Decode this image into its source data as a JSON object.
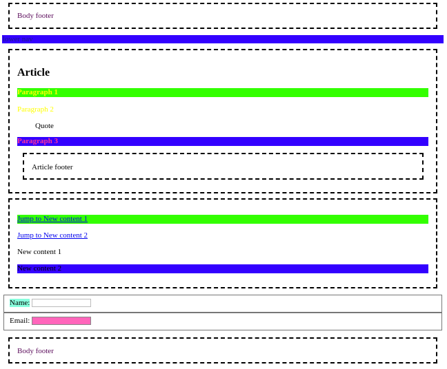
{
  "top_footer": {
    "text": "Body footer"
  },
  "lower_nav": {
    "text": "lower nav"
  },
  "article": {
    "title": "Article",
    "paragraph_1": "Paragraph 1",
    "paragraph_2": "Paragraph 2",
    "quote": "Quote",
    "paragraph_3": "Paragraph 3",
    "footer": "Article footer"
  },
  "nav_section": {
    "jump_1": "Jump to New content 1",
    "jump_2": "Jump to New content 2",
    "content_1": "New content 1",
    "content_2": "New content 2"
  },
  "form": {
    "name_label": "Name:",
    "name_value": "",
    "email_label": "Email:",
    "email_value": ""
  },
  "bottom_footer": {
    "text": "Body footer"
  },
  "colors": {
    "green_bar": "#33ff00",
    "blue_bar": "#3300ff",
    "yellow_text": "#ffff00",
    "pink_text": "#ff3399",
    "name_label_bg": "#88ffdd",
    "email_input_bg": "#ff66bb",
    "footer_text": "#5a0a5a"
  }
}
